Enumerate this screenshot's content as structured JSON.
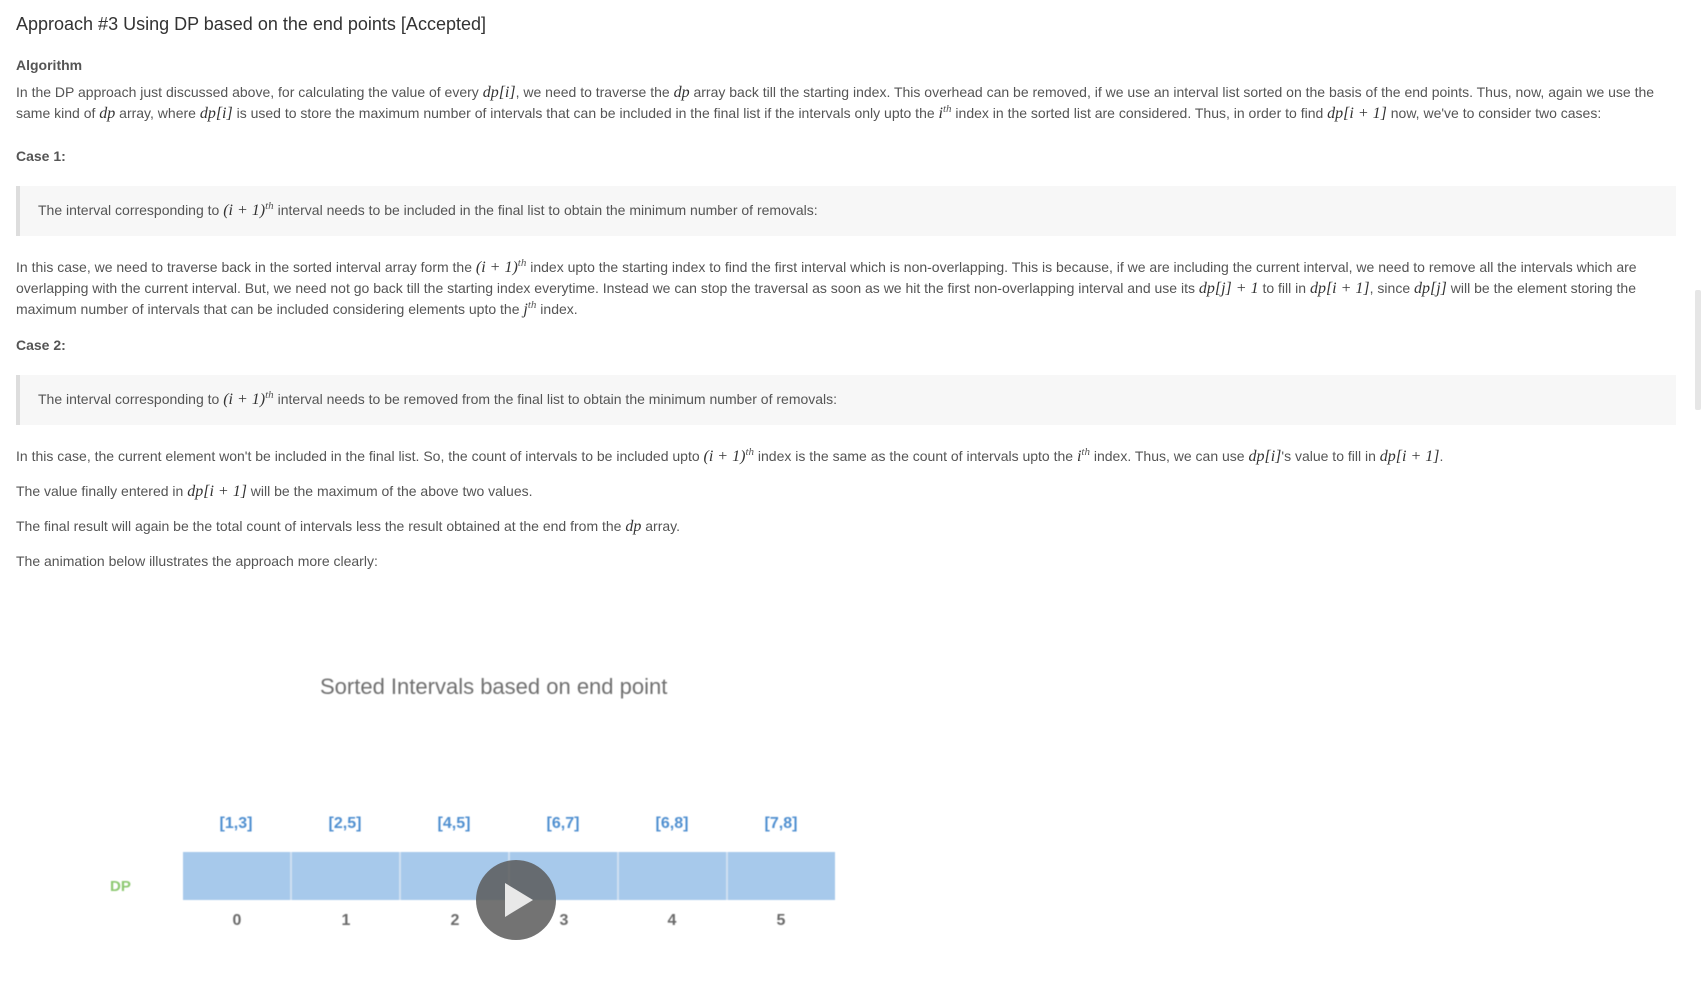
{
  "title": "Approach #3 Using DP based on the end points [Accepted]",
  "algorithm_heading": "Algorithm",
  "intro": {
    "t1": "In the DP approach just discussed above, for calculating the value of every ",
    "t2": ", we need to traverse the ",
    "t3": " array back till the starting index. This overhead can be removed, if we use an interval list sorted on the basis of the end points. Thus, now, again we use the same kind of ",
    "t4": " array, where ",
    "t5": " is used to store the maximum number of intervals that can be included in the final list if the intervals only upto the ",
    "t6": " index in the sorted list are considered. Thus, in order to find ",
    "t7": " now, we've to consider two cases:"
  },
  "case1": {
    "heading": "Case 1:",
    "quote_pre": "The interval corresponding to ",
    "quote_post": " interval needs to be included in the final list to obtain the minimum number of removals:",
    "p1": "In this case, we need to traverse back in the sorted interval array form the ",
    "p2": " index upto the starting index to find the first interval which is non-overlapping. This is because, if we are including the current interval, we need to remove all the intervals which are overlapping with the current interval. But, we need not go back till the starting index everytime. Instead we can stop the traversal as soon as we hit the first non-overlapping interval and use its ",
    "p3": " to fill in ",
    "p4": ", since ",
    "p5": " will be the element storing the maximum number of intervals that can be included considering elements upto the ",
    "p6": " index."
  },
  "case2": {
    "heading": "Case 2:",
    "quote_pre": "The interval corresponding to ",
    "quote_post": " interval needs to be removed from the final list to obtain the minimum number of removals:",
    "p1": "In this case, the current element won't be included in the final list. So, the count of intervals to be included upto ",
    "p2": " index is the same as the count of intervals upto the ",
    "p3": " index. Thus, we can use ",
    "p4": "'s value to fill in ",
    "p5": "."
  },
  "final_value": {
    "p1": "The value finally entered in ",
    "p2": " will be the maximum of the above two values."
  },
  "final_result": {
    "p1": "The final result will again be the total count of intervals less the result obtained at the end from the ",
    "p2": " array."
  },
  "animation_note": "The animation below illustrates the approach more clearly:",
  "math": {
    "dp_i": "dp[i]",
    "dp": "dp",
    "i_base": "i",
    "th": "th",
    "j_base": "j",
    "dp_i1": "dp[i + 1]",
    "i1_paren": "(i + 1)",
    "dp_j_plus1": "dp[j] + 1",
    "dp_j": "dp[j]"
  },
  "animation": {
    "title": "Sorted Intervals based on end point",
    "intervals": [
      "[1,3]",
      "[2,5]",
      "[4,5]",
      "[6,7]",
      "[6,8]",
      "[7,8]"
    ],
    "dp_label": "DP",
    "indices": [
      "0",
      "1",
      "2",
      "3",
      "4",
      "5"
    ],
    "colors": {
      "cell": "#a7c9eb",
      "interval_text": "#4f8fd0",
      "dp_label": "#8cc870"
    }
  }
}
